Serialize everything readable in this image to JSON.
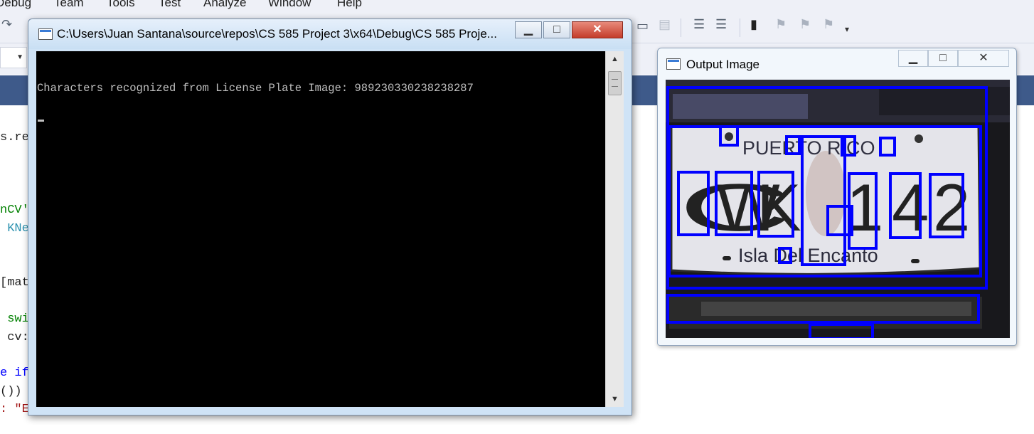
{
  "vs": {
    "menu": [
      "Debug",
      "Team",
      "Tools",
      "Test",
      "Analyze",
      "Window",
      "Help"
    ],
    "code_fragments": [
      "s.re",
      "nCV'",
      " KNe",
      "[mat",
      " swi",
      " cv:",
      "e if",
      "())",
      ": \"E"
    ]
  },
  "console": {
    "title": "C:\\Users\\Juan Santana\\source\\repos\\CS 585 Project 3\\x64\\Debug\\CS 585 Proje...",
    "output_line": "Characters recognized from License Plate Image: 989230330238238287",
    "buttons": {
      "minimize": "▁",
      "maximize": "□",
      "close": "✕"
    },
    "scroll_up": "▲",
    "scroll_down": "▼"
  },
  "output_window": {
    "title": "Output Image",
    "buttons": {
      "minimize": "▁",
      "maximize": "□",
      "close": "✕"
    },
    "plate": {
      "top_text": "PUERTO RICO",
      "main_text": [
        "C",
        "W",
        "K",
        "1",
        "4",
        "2"
      ],
      "bottom_text": "Isla Del Encanto"
    },
    "box_color": "#0000ff"
  }
}
